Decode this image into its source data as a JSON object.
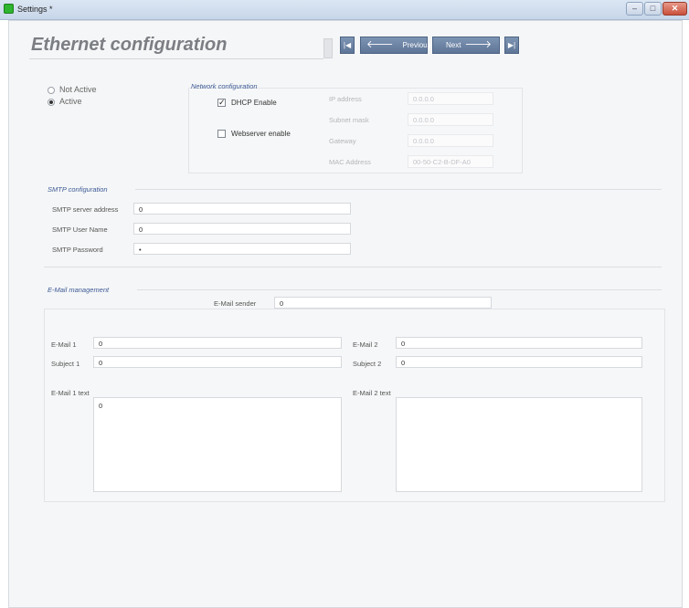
{
  "window": {
    "title": "Settings *",
    "minimize_glyph": "–",
    "maximize_glyph": "□",
    "close_glyph": "✕"
  },
  "page": {
    "title": "Ethernet configuration"
  },
  "nav": {
    "first_glyph": "|◀",
    "prev_arrow": "🡐",
    "prev_label": "Previous",
    "next_label": "Next",
    "next_arrow": "🡒",
    "last_glyph": "▶|"
  },
  "status": {
    "options": [
      {
        "label": "Not Active",
        "selected": false
      },
      {
        "label": "Active",
        "selected": true
      }
    ]
  },
  "network": {
    "section_title": "Network configuration",
    "dhcp": {
      "label": "DHCP Enable",
      "checked": true,
      "mark": "✓"
    },
    "webserver": {
      "label": "Webserver enable",
      "checked": false,
      "mark": ""
    },
    "fields": [
      {
        "label": "IP address",
        "value": "0.0.0.0"
      },
      {
        "label": "Subnet mask",
        "value": "0.0.0.0"
      },
      {
        "label": "Gateway",
        "value": "0.0.0.0"
      },
      {
        "label": "MAC Address",
        "value": "00-50-C2-B-DF-A0"
      }
    ]
  },
  "smtp": {
    "section_title": "SMTP configuration",
    "fields": [
      {
        "label": "SMTP server address",
        "value": "0"
      },
      {
        "label": "SMTP User Name",
        "value": "0"
      },
      {
        "label": "SMTP Password",
        "value": "•"
      }
    ]
  },
  "email": {
    "section_title": "E-Mail management",
    "sender": {
      "label": "E-Mail sender",
      "value": "0"
    },
    "email1": {
      "label": "E-Mail 1",
      "value": "0"
    },
    "subject1": {
      "label": "Subject 1",
      "value": "0"
    },
    "email2": {
      "label": "E-Mail 2",
      "value": "0"
    },
    "subject2": {
      "label": "Subject 2",
      "value": "0"
    },
    "text1": {
      "label": "E-Mail 1 text",
      "value": "0"
    },
    "text2": {
      "label": "E-Mail 2 text",
      "value": ""
    }
  }
}
